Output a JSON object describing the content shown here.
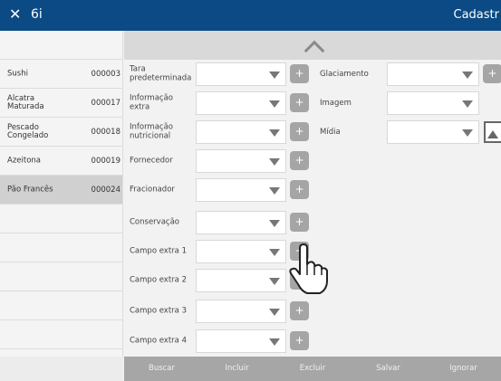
{
  "titlebar": {
    "close_icon": "close-icon",
    "app": "6i",
    "screen": "Cadastr",
    "color": "#0b4a84"
  },
  "products": [
    {
      "name": "Sushi",
      "code": "000003"
    },
    {
      "name": "Alcatra Maturada",
      "code": "000017"
    },
    {
      "name": "Pescado Congelado",
      "code": "000018"
    },
    {
      "name": "Azeitona",
      "code": "000019"
    },
    {
      "name": "Pão Francês",
      "code": "000024"
    }
  ],
  "selected_product": "Pão Francês",
  "fields": [
    "Tara predeterminada",
    "Informação extra",
    "Informação nutricional",
    "Fornecedor",
    "Fracionador",
    "Conservação",
    "Campo extra 1",
    "Campo extra 2",
    "Campo extra 3",
    "Campo extra 4"
  ],
  "fields_right": [
    "Glaciamento",
    "Imagem",
    "Mídia"
  ],
  "plus_label": "+",
  "actions": [
    "Buscar",
    "Incluir",
    "Excluir",
    "Salvar",
    "Ignorar"
  ]
}
